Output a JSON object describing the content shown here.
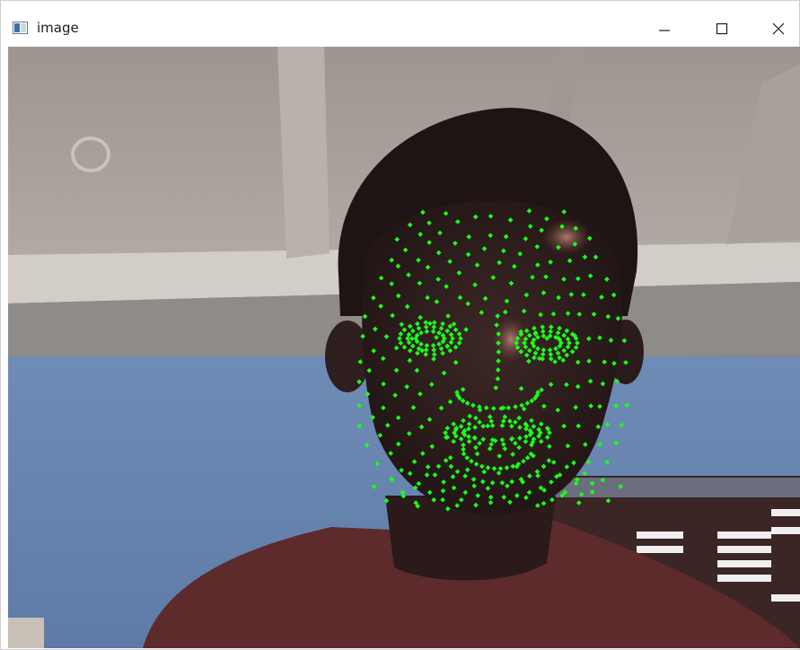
{
  "window": {
    "title": "image",
    "icon": "window-app-icon",
    "controls": [
      {
        "name": "minimize",
        "icon": "minimize-icon"
      },
      {
        "name": "maximize",
        "icon": "maximize-icon"
      },
      {
        "name": "close",
        "icon": "close-icon"
      }
    ]
  },
  "content": {
    "type": "camera-frame-with-face-mesh-overlay",
    "overlay_color": "#19ff19"
  }
}
